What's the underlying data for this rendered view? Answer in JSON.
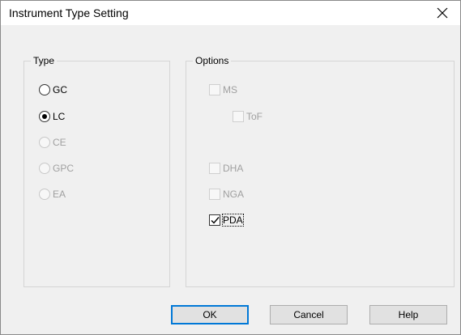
{
  "window": {
    "title": "Instrument Type Setting",
    "close_icon": "close-icon"
  },
  "type_group": {
    "label": "Type",
    "options": [
      {
        "label": "GC",
        "checked": false,
        "enabled": true
      },
      {
        "label": "LC",
        "checked": true,
        "enabled": true
      },
      {
        "label": "CE",
        "checked": false,
        "enabled": false
      },
      {
        "label": "GPC",
        "checked": false,
        "enabled": false
      },
      {
        "label": "EA",
        "checked": false,
        "enabled": false
      }
    ]
  },
  "options_group": {
    "label": "Options",
    "items": [
      {
        "label": "MS",
        "checked": false,
        "enabled": false
      },
      {
        "label": "ToF",
        "checked": false,
        "enabled": false
      },
      {
        "label": "DHA",
        "checked": false,
        "enabled": false
      },
      {
        "label": "NGA",
        "checked": false,
        "enabled": false
      },
      {
        "label": "PDA",
        "checked": true,
        "enabled": true,
        "focused": true
      }
    ]
  },
  "buttons": {
    "ok": "OK",
    "cancel": "Cancel",
    "help": "Help"
  },
  "colors": {
    "accent": "#0078d7",
    "disabled_text": "#a0a0a0"
  }
}
